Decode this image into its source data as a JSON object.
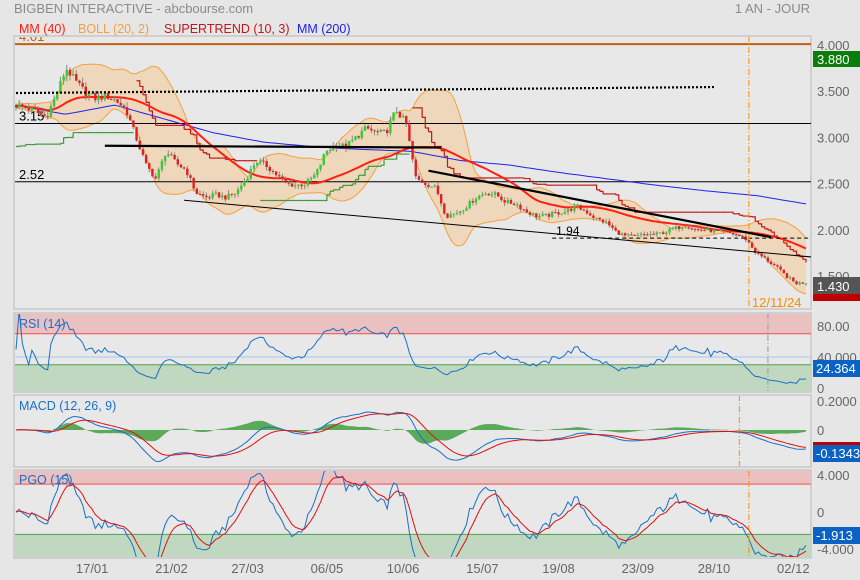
{
  "header": {
    "title": "BIGBEN INTERACTIVE - abcbourse.com",
    "period": "1 AN - JOUR"
  },
  "legend": {
    "mm40": "MM (40)",
    "boll": "BOLL (20, 2)",
    "supertrend": "SUPERTREND (10, 3)",
    "mm200": "MM (200)"
  },
  "colors": {
    "up": "#33cc33",
    "down": "#e02020",
    "wick": "#8a8a8a",
    "mm40": "#ff2010",
    "mm200": "#2020ee",
    "boll_fill": "#efd3b3",
    "boll_line": "#f4a040",
    "st_up": "#3a9a3a",
    "st_down": "#c01818",
    "level": "#c06010",
    "marker": "#ff8c00",
    "ind_line": "#1a6fc9",
    "ind_signal": "#e01010",
    "hist": "#5aaa5a",
    "zone_high": "#eac0c0",
    "zone_low": "#c0d8c0",
    "badge_blue": "#0a62c4",
    "badge_green": "#0a7d0a",
    "badge_gray": "#555555",
    "badge_red": "#c00000"
  },
  "chart_data": {
    "type": "candlestick",
    "title": "BIGBEN INTERACTIVE",
    "days": 250,
    "x_ticks": [
      {
        "day": 24,
        "label": "17/01"
      },
      {
        "day": 49,
        "label": "21/02"
      },
      {
        "day": 73,
        "label": "27/03"
      },
      {
        "day": 98,
        "label": "06/05"
      },
      {
        "day": 122,
        "label": "10/06"
      },
      {
        "day": 147,
        "label": "15/07"
      },
      {
        "day": 171,
        "label": "19/08"
      },
      {
        "day": 196,
        "label": "23/09"
      },
      {
        "day": 220,
        "label": "28/10"
      },
      {
        "day": 245,
        "label": "02/12"
      }
    ],
    "close_keyframes": [
      3.35,
      3.32,
      3.28,
      3.22,
      3.45,
      3.75,
      3.6,
      3.48,
      3.42,
      3.45,
      3.4,
      3.3,
      3.0,
      2.7,
      2.55,
      2.85,
      2.72,
      2.65,
      2.4,
      2.35,
      2.38,
      2.35,
      2.4,
      2.55,
      2.75,
      2.7,
      2.6,
      2.5,
      2.48,
      2.5,
      2.6,
      2.85,
      2.92,
      2.9,
      3.0,
      3.1,
      3.05,
      3.05,
      3.3,
      3.15,
      2.55,
      2.5,
      2.45,
      2.15,
      2.18,
      2.25,
      2.35,
      2.4,
      2.38,
      2.3,
      2.28,
      2.2,
      2.15,
      2.15,
      2.18,
      2.2,
      2.25,
      2.2,
      2.12,
      2.08,
      1.98,
      1.93,
      1.93,
      1.95,
      1.95,
      1.98,
      2.02,
      2.05,
      2.0,
      2.0,
      1.98,
      1.97,
      1.95,
      1.9,
      1.75,
      1.68,
      1.6,
      1.5,
      1.42,
      1.43
    ],
    "mm200_keyframes": [
      3.35,
      3.25,
      3.35,
      3.2,
      3.05,
      2.95,
      2.9,
      2.87,
      2.85,
      2.75,
      2.7,
      2.62,
      2.55,
      2.48,
      2.42,
      2.37,
      2.28
    ],
    "price_axis": {
      "ticks": [
        {
          "v": 4.0,
          "label": "4.000"
        },
        {
          "v": 3.5,
          "label": "3.500"
        },
        {
          "v": 3.0,
          "label": "3.000"
        },
        {
          "v": 2.5,
          "label": "2.500"
        },
        {
          "v": 2.0,
          "label": "2.000"
        },
        {
          "v": 1.5,
          "label": "1.500"
        }
      ],
      "ylim": [
        1.35,
        4.1
      ]
    },
    "levels": [
      {
        "value": 4.01,
        "label": "4.01",
        "style": "resistance"
      },
      {
        "value": 3.15,
        "label": "3.15",
        "style": "support"
      },
      {
        "value": 2.52,
        "label": "2.52",
        "style": "support"
      }
    ],
    "trendlines": [
      {
        "from": [
          0,
          3.48
        ],
        "to": [
          220,
          3.545
        ],
        "style": "dotted"
      },
      {
        "from": [
          28,
          2.91
        ],
        "to": [
          134,
          2.89
        ],
        "style": "thick"
      },
      {
        "from": [
          53,
          2.32
        ],
        "to": [
          251,
          1.705
        ],
        "style": "thin"
      },
      {
        "from": [
          130,
          2.64
        ],
        "to": [
          238,
          1.92
        ],
        "style": "thick"
      },
      {
        "from": [
          169,
          1.91
        ],
        "to": [
          251,
          1.91
        ],
        "style": "dashed",
        "label": "1.94"
      }
    ],
    "marker": {
      "day": 231,
      "label": "12/11/24"
    },
    "badges": {
      "high": "3.880",
      "last": "1.430"
    }
  },
  "panels": {
    "rsi": {
      "label": "RSI (14)",
      "ticks": [
        {
          "v": 80,
          "label": "80.00"
        },
        {
          "v": 40,
          "label": "40.000"
        },
        {
          "v": 0,
          "label": "0"
        }
      ],
      "value": "24.364",
      "high": 70,
      "low": 30,
      "mid": 40
    },
    "macd": {
      "label": "MACD (12, 26, 9)",
      "ticks": [
        {
          "v": 0.2,
          "label": "0.2000"
        },
        {
          "v": 0,
          "label": "0"
        }
      ],
      "value": "-0.1343"
    },
    "pgo": {
      "label": "PGO (15)",
      "ticks": [
        {
          "v": 4,
          "label": "4.000"
        },
        {
          "v": 0,
          "label": "0"
        },
        {
          "v": -4,
          "label": "-4.000"
        }
      ],
      "value": "-1.913",
      "high": 3,
      "low": -2.4
    }
  }
}
